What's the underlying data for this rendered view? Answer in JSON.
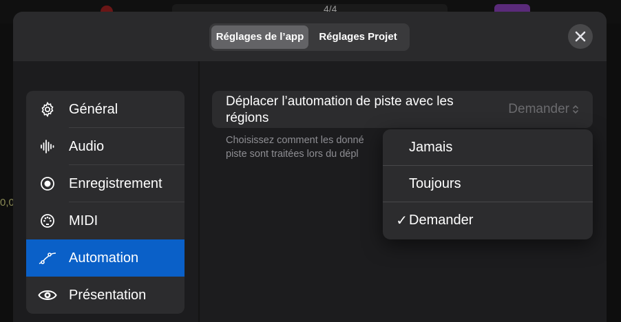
{
  "background": {
    "time_sig": "4/4",
    "edge_text": "0,0"
  },
  "header": {
    "tabs": [
      {
        "label": "Réglages de l’app",
        "active": true
      },
      {
        "label": "Réglages Projet",
        "active": false
      }
    ],
    "close_icon": "xmark-icon"
  },
  "sidebar": {
    "items": [
      {
        "label": "Général",
        "icon": "gear-icon",
        "selected": false
      },
      {
        "label": "Audio",
        "icon": "waveform-icon",
        "selected": false
      },
      {
        "label": "Enregistrement",
        "icon": "record-circle-icon",
        "selected": false
      },
      {
        "label": "MIDI",
        "icon": "midi-connector-icon",
        "selected": false
      },
      {
        "label": "Automation",
        "icon": "automation-curve-icon",
        "selected": true
      },
      {
        "label": "Présentation",
        "icon": "eye-icon",
        "selected": false
      }
    ],
    "accent": "#0a60c8"
  },
  "setting": {
    "label": "Déplacer l’automation de piste avec les régions",
    "value": "Demander",
    "description_line1": "Choisissez comment les donné",
    "description_line2": "piste sont traitées lors du dépl"
  },
  "dropdown": {
    "options": [
      {
        "label": "Jamais",
        "checked": false
      },
      {
        "label": "Toujours",
        "checked": false
      },
      {
        "label": "Demander",
        "checked": true
      }
    ],
    "check_glyph": "✓"
  }
}
